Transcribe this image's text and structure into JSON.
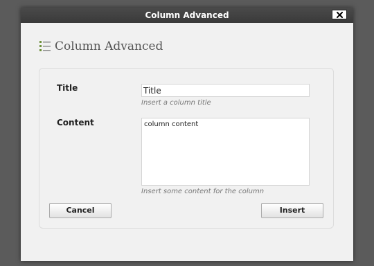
{
  "dialog": {
    "title": "Column Advanced",
    "close_icon": "close-icon"
  },
  "heading": {
    "icon": "list-icon",
    "text": "Column Advanced",
    "icon_color": "#6e8f3a"
  },
  "form": {
    "title_label": "Title",
    "title_value": "Title",
    "title_hint": "Insert a column title",
    "content_label": "Content",
    "content_value": "column content",
    "content_hint": "Insert some content for the column"
  },
  "buttons": {
    "cancel_label": "Cancel",
    "insert_label": "Insert"
  }
}
